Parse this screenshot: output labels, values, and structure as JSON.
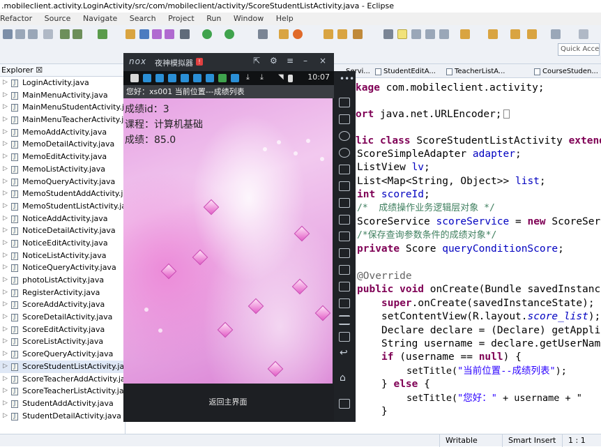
{
  "window": {
    "title": ".mobileclient.activity.LoginActivity/src/com/mobileclient/activity/ScoreStudentListActivity.java - Eclipse"
  },
  "menu": [
    "Refactor",
    "Source",
    "Navigate",
    "Search",
    "Project",
    "Run",
    "Window",
    "Help"
  ],
  "toolbar": {
    "quick_access_placeholder": "Quick Acce"
  },
  "explorer": {
    "tab_label": "Explorer ☒",
    "files": [
      "LoginActivity.java",
      "MainMenuActivity.java",
      "MainMenuStudentActivity.java",
      "MainMenuTeacherActivity.java",
      "MemoAddActivity.java",
      "MemoDetailActivity.java",
      "MemoEditActivity.java",
      "MemoListActivity.java",
      "MemoQueryActivity.java",
      "MemoStudentAddActivity.java",
      "MemoStudentListActivity.java",
      "NoticeAddActivity.java",
      "NoticeDetailActivity.java",
      "NoticeEditActivity.java",
      "NoticeListActivity.java",
      "NoticeQueryActivity.java",
      "photoListActivity.java",
      "RegisterActivity.java",
      "ScoreAddActivity.java",
      "ScoreDetailActivity.java",
      "ScoreEditActivity.java",
      "ScoreListActivity.java",
      "ScoreQueryActivity.java",
      "ScoreStudentListActivity.java",
      "ScoreTeacherAddActivity.java",
      "ScoreTeacherListActivity.java",
      "StudentAddActivity.java",
      "StudentDetailActivity.java"
    ]
  },
  "editor_tabs": [
    "Servi...",
    "StudentEditA...",
    "TeacherListA...",
    "CourseStuden..."
  ],
  "code": {
    "l1_kw": "kage",
    "l1_rest": " com.mobileclient.activity;",
    "l2_kw": "ort",
    "l2_rest": " java.net.URLEncoder;",
    "l3_kw1": "lic",
    "l3_kw2": "class",
    "l3_rest": " ScoreStudentListActivity ",
    "l3_kw3": "extends",
    "l4_type": "ScoreSimpleAdapter ",
    "l4_field": "adapter",
    "l4_end": ";",
    "l5_type": "ListView ",
    "l5_field": "lv",
    "l5_end": ";",
    "l6_type": "List<Map<String, Object>> ",
    "l6_field": "list",
    "l6_end": ";",
    "l7_kw": "int",
    "l7_field": " scoreId",
    "l7_end": ";",
    "l8_cmt": "/*  成绩操作业务逻辑层对象 */",
    "l9_type": "ScoreService ",
    "l9_field": "scoreService",
    "l9_mid": " = ",
    "l9_kw": "new",
    "l9_rest": " ScoreSer",
    "l10_cmt": "/*保存查询参数条件的成绩对象*/",
    "l11_kw": "private",
    "l11_type": " Score ",
    "l11_field": "queryConditionScore",
    "l11_end": ";",
    "l12_ann": "@Override",
    "l13_kw1": "public",
    "l13_kw2": " void",
    "l13_rest": " onCreate(Bundle savedInstanc",
    "l14_kw": "super",
    "l14_rest": ".onCreate(savedInstanceState);",
    "l15_pre": "setContentView(R.layout.",
    "l15_ital": "score_list",
    "l15_end": ");",
    "l16": "Declare declare = (Declare) getAppli",
    "l17": "String username = declare.getUserNam",
    "l18_kw": "if",
    "l18_mid": " (username == ",
    "l18_kw2": "null",
    "l18_end": ") {",
    "l19_pre": "setTitle(",
    "l19_str": "\"当前位置--成绩列表\"",
    "l19_end": ");",
    "l20_pre": "} ",
    "l20_kw": "else",
    "l20_end": " {",
    "l21_pre": "setTitle(",
    "l21_str": "\"您好：\"",
    "l21_end": " + username + \"",
    "l22": "}"
  },
  "status": {
    "writable": "Writable",
    "insert": "Smart Insert",
    "position": "1 : 1"
  },
  "nox": {
    "logo": "nox",
    "name": "夜神模拟器",
    "badge": "!",
    "clock": "10:07",
    "app_bar": "您好：xs001   当前位置---成绩列表",
    "score_id": "成绩id：3",
    "course": "课程：计算机基础",
    "score": "成绩：85.0",
    "back_button": "返回主界面"
  }
}
